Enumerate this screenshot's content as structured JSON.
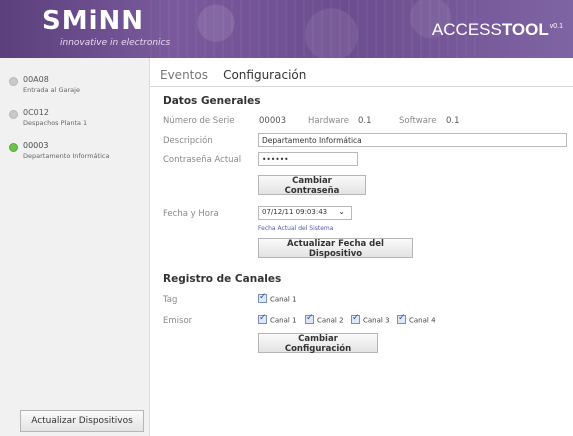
{
  "header": {
    "logo": "SMiNN",
    "tagline": "innovative in electronics",
    "brand_prefix": "ACCESS",
    "brand_bold": "TOOL",
    "brand_version": "v0.1"
  },
  "sidebar": {
    "devices": [
      {
        "code": "00A08",
        "desc": "Entrada al Garaje",
        "active": false
      },
      {
        "code": "0C012",
        "desc": "Despachos Planta 1",
        "active": false
      },
      {
        "code": "00003",
        "desc": "Departamento Informática",
        "active": true
      }
    ],
    "update_button": "Actualizar Dispositivos"
  },
  "tabs": [
    {
      "label": "Eventos",
      "active": false
    },
    {
      "label": "Configuración",
      "active": true
    }
  ],
  "general": {
    "title": "Datos Generales",
    "serial_label": "Número de Serie",
    "serial_value": "00003",
    "hardware_label": "Hardware",
    "hardware_value": "0.1",
    "software_label": "Software",
    "software_value": "0.1",
    "description_label": "Descripción",
    "description_value": "Departamento Informática",
    "password_label": "Contraseña Actual",
    "password_value": "••••••",
    "change_password_button": "Cambiar Contraseña",
    "datetime_label": "Fecha y Hora",
    "datetime_value": "07/12/11 09:03:43",
    "datetime_hint": "Fecha Actual del Sistema",
    "update_datetime_button": "Actualizar Fecha del Dispositivo"
  },
  "channels": {
    "title": "Registro de Canales",
    "tag_label": "Tag",
    "tag_channels": [
      "Canal 1"
    ],
    "emitter_label": "Emisor",
    "emitter_channels": [
      "Canal 1",
      "Canal 2",
      "Canal 3",
      "Canal 4"
    ],
    "change_config_button": "Cambiar Configuración"
  },
  "colors": {
    "header": "#6c4d8f",
    "active_dot": "#6cc24a",
    "inactive_dot": "#c9c9c9"
  }
}
